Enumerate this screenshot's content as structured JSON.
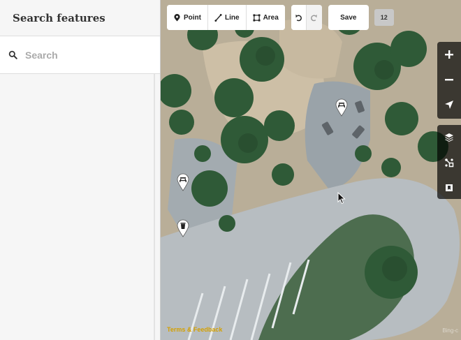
{
  "sidebar": {
    "title": "Search features",
    "search_placeholder": "Search"
  },
  "toolbar": {
    "point_label": "Point",
    "line_label": "Line",
    "area_label": "Area",
    "save_label": "Save",
    "edit_count": "12"
  },
  "map": {
    "footer_link": "Terms & Feedback",
    "attribution": "Bing-c"
  },
  "colors": {
    "accent": "#d4a000",
    "vegetation": "#2f5a37",
    "ground": "#c8b79c",
    "pavement": "#b8bec3"
  },
  "icons": [
    "search-icon",
    "point-icon",
    "line-icon",
    "area-icon",
    "undo-icon",
    "redo-icon",
    "zoom-in-icon",
    "zoom-out-icon",
    "locate-icon",
    "layers-icon",
    "map-data-icon",
    "help-icon",
    "picnic-pin-icon",
    "trash-pin-icon"
  ]
}
